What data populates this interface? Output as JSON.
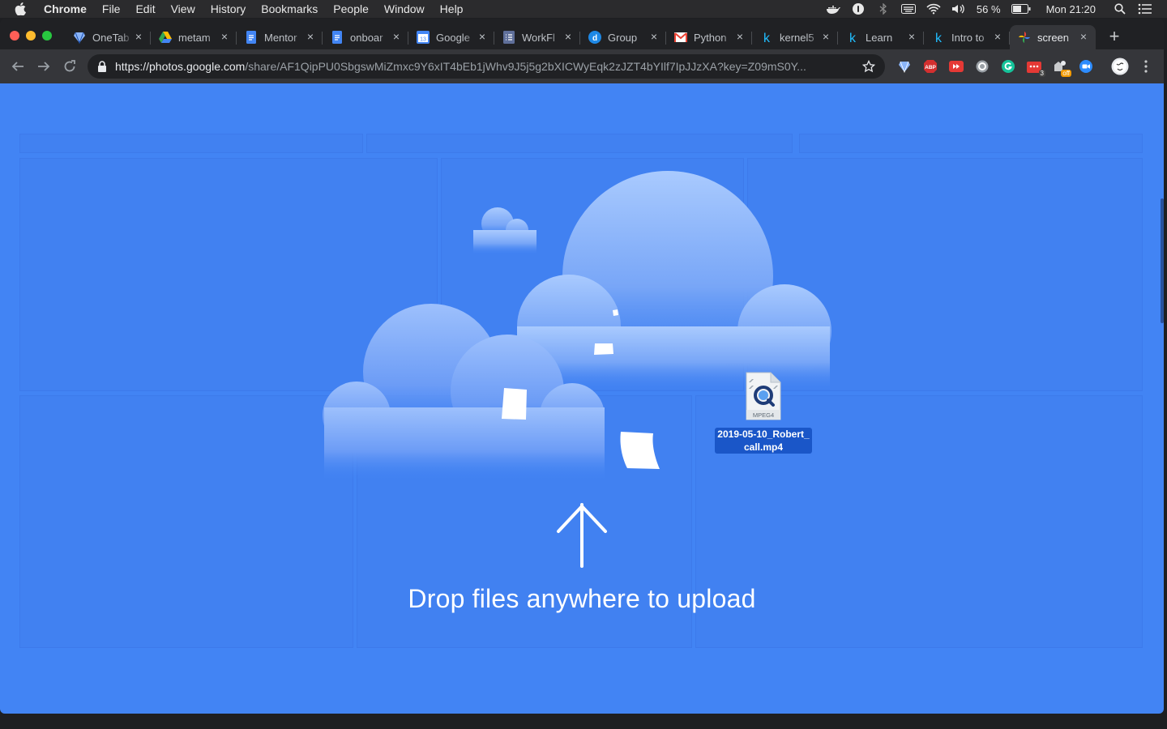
{
  "menubar": {
    "app_name": "Chrome",
    "items": [
      "File",
      "Edit",
      "View",
      "History",
      "Bookmarks",
      "People",
      "Window",
      "Help"
    ],
    "battery_percent": "56 %",
    "clock": "Mon 21:20"
  },
  "tabs": [
    {
      "title": "OneTab",
      "icon": "onetab-icon"
    },
    {
      "title": "metam",
      "icon": "google-drive-icon"
    },
    {
      "title": "Mentor",
      "icon": "google-docs-icon"
    },
    {
      "title": "onboar",
      "icon": "google-docs-icon"
    },
    {
      "title": "Google",
      "icon": "google-calendar-icon"
    },
    {
      "title": "WorkFl",
      "icon": "google-forms-icon"
    },
    {
      "title": "Group",
      "icon": "d-app-icon"
    },
    {
      "title": "Python",
      "icon": "gmail-icon"
    },
    {
      "title": "kernel5",
      "icon": "k-icon"
    },
    {
      "title": "Learn",
      "icon": "k-icon"
    },
    {
      "title": "Intro to",
      "icon": "k-icon"
    },
    {
      "title": "screen",
      "icon": "google-photos-icon",
      "active": true
    }
  ],
  "address_bar": {
    "host": "https://photos.google.com",
    "path": "/share/AF1QipPU0SbgswMiZmxc9Y6xIT4bEb1jWhv9J5j5g2bXICWyEqk2zJZT4bYIlf7IpJJzXA?key=Z09mS0Y..."
  },
  "extensions": [
    {
      "name": "onetab-ext-icon"
    },
    {
      "name": "adblock-ext-icon",
      "label": "ABP"
    },
    {
      "name": "video-speed-ext-icon"
    },
    {
      "name": "circle-ext-icon"
    },
    {
      "name": "grammarly-ext-icon"
    },
    {
      "name": "calendar-ext-icon",
      "badge": "3"
    },
    {
      "name": "cookie-ext-icon",
      "badge": "off"
    },
    {
      "name": "zoom-ext-icon"
    }
  ],
  "content": {
    "drop_message": "Drop files anywhere to upload",
    "dragged_file": {
      "name": "2019-05-10_Robert_call.mp4",
      "type_label": "MPEG4"
    }
  },
  "colors": {
    "overlay_blue": "#4284f4",
    "file_label_bg": "#1a56c8"
  }
}
